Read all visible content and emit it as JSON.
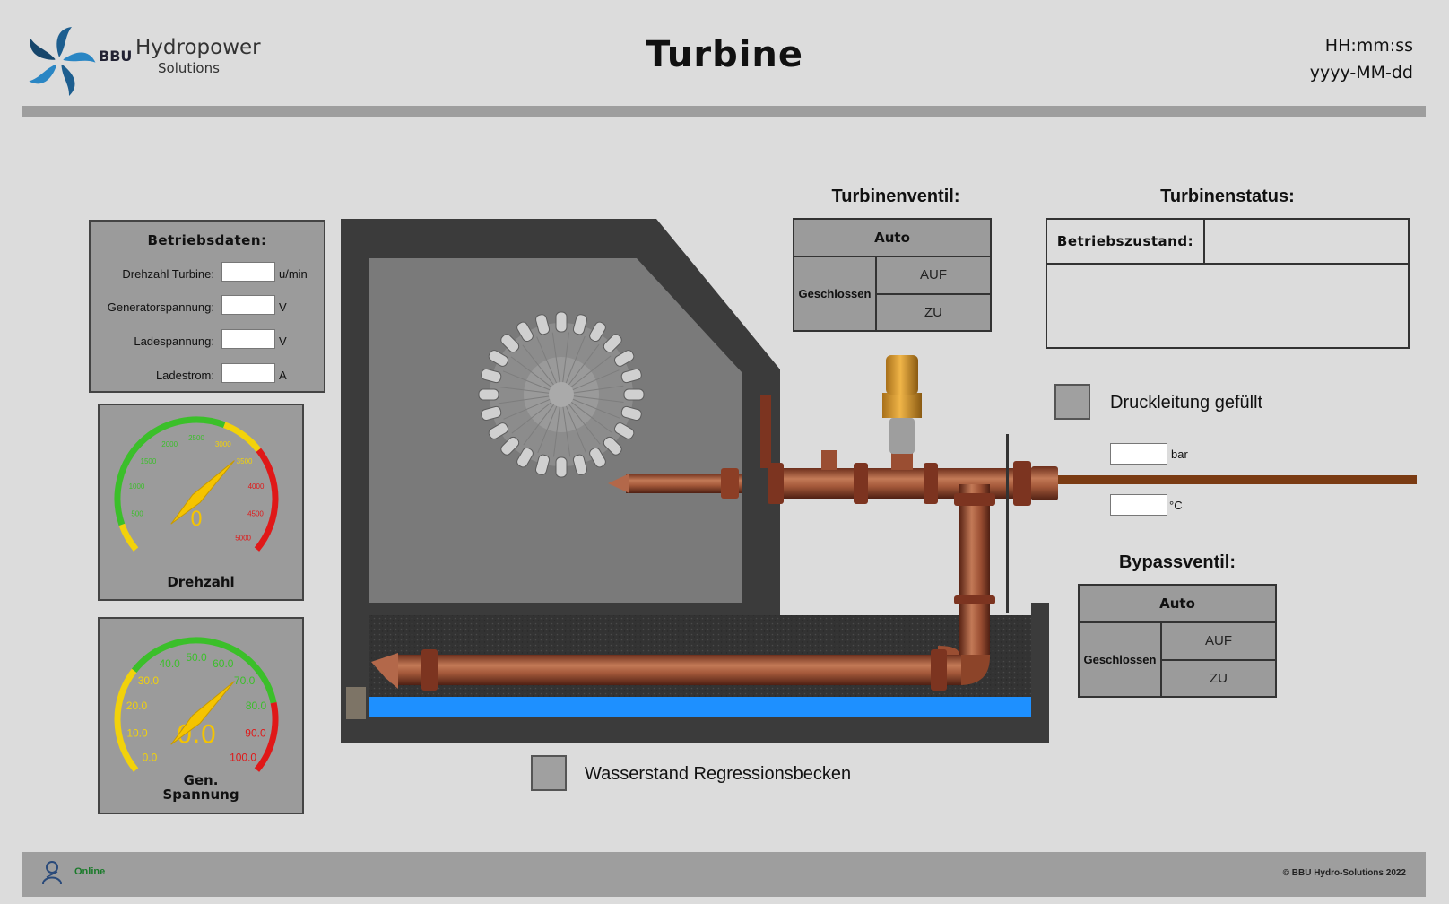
{
  "header": {
    "title": "Turbine",
    "time_format": "HH:mm:ss",
    "date_format": "yyyy-MM-dd",
    "logo": {
      "abbr": "BBU",
      "name": "Hydropower",
      "sub": "Solutions"
    }
  },
  "betriebsdaten": {
    "title": "Betriebsdaten:",
    "rows": [
      {
        "label": "Drehzahl Turbine:",
        "unit": "u/min",
        "value": ""
      },
      {
        "label": "Generatorspannung:",
        "unit": "V",
        "value": ""
      },
      {
        "label": "Ladespannung:",
        "unit": "V",
        "value": ""
      },
      {
        "label": "Ladestrom:",
        "unit": "A",
        "value": ""
      }
    ]
  },
  "gauges": {
    "rpm": {
      "label": "Drehzahl",
      "value_text": "0",
      "value": 0,
      "min": 0,
      "max": 5000,
      "ticks": [
        "500",
        "1000",
        "1500",
        "2000",
        "2500",
        "3000",
        "3500",
        "4000",
        "4500",
        "5000"
      ]
    },
    "voltage": {
      "label_line1": "Gen.",
      "label_line2": "Spannung",
      "value_text": "0.0",
      "value": 0,
      "min": 0,
      "max": 100,
      "ticks": [
        "0.0",
        "10.0",
        "20.0",
        "30.0",
        "40.0",
        "50.0",
        "60.0",
        "70.0",
        "80.0",
        "90.0",
        "100.0"
      ]
    }
  },
  "turbinenventil": {
    "title": "Turbinenventil:",
    "auto": "Auto",
    "closed": "Geschlossen",
    "up": "AUF",
    "down": "ZU"
  },
  "bypassventil": {
    "title": "Bypassventil:",
    "auto": "Auto",
    "closed": "Geschlossen",
    "up": "AUF",
    "down": "ZU"
  },
  "turbinenstatus": {
    "title": "Turbinenstatus:",
    "label": "Betriebszustand:",
    "value": "",
    "message": ""
  },
  "druckleitung": {
    "label": "Druckleitung gefüllt",
    "pressure_unit": "bar",
    "temp_unit": "°C",
    "pressure_value": "",
    "temp_value": ""
  },
  "wasserstand": {
    "label": "Wasserstand Regressionsbecken"
  },
  "footer": {
    "status": "Online",
    "copyright": "© BBU Hydro-Solutions 2022"
  },
  "colors": {
    "background": "#dcdcdc",
    "panel": "#9b9b9b",
    "pipe": "#9a4e32",
    "water": "#1e90ff",
    "gauge_green": "#3bbf2a",
    "gauge_yellow": "#f2d20a",
    "gauge_red": "#e01818",
    "needle": "#f5c400"
  }
}
